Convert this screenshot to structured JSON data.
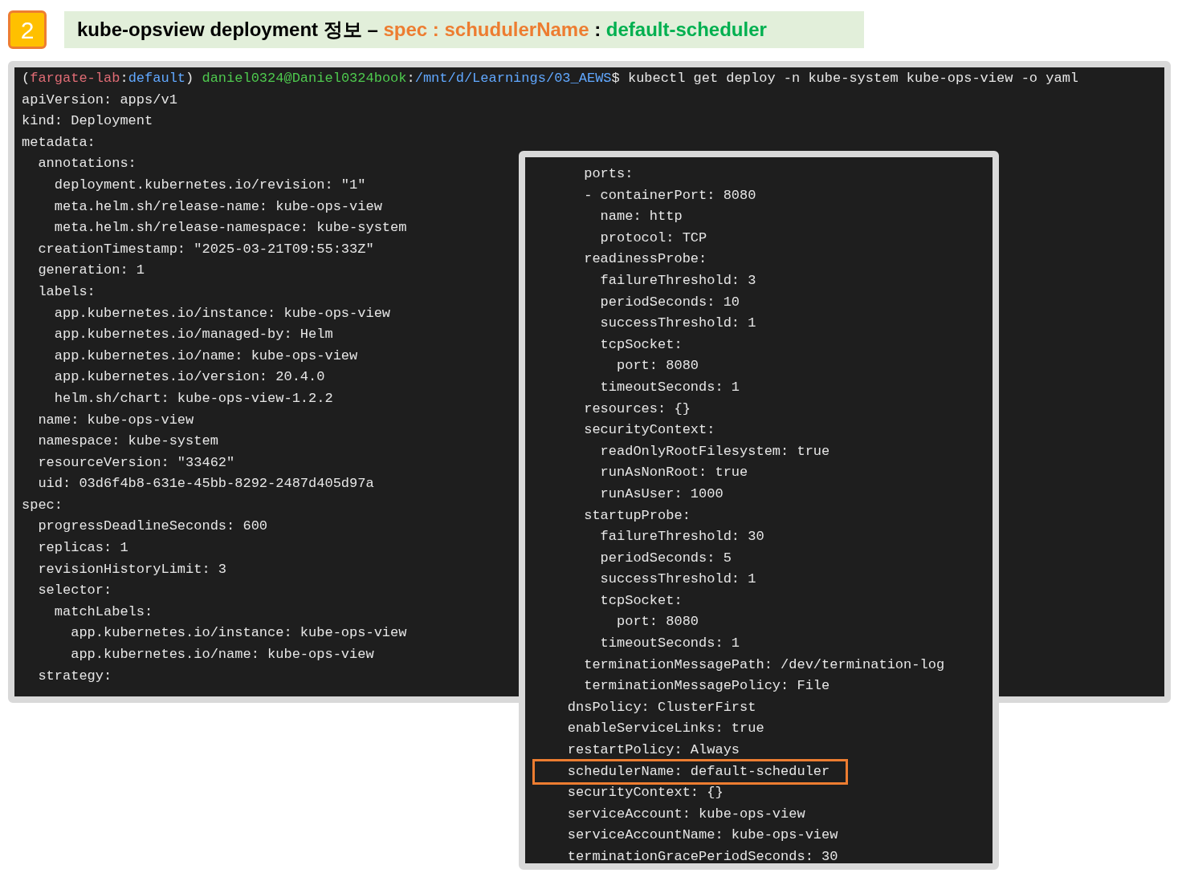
{
  "header": {
    "badge": "2",
    "title": [
      {
        "kind": "plain",
        "text": "kube-opsview deployment 정보 – "
      },
      {
        "kind": "key",
        "text": "spec : schudulerName"
      },
      {
        "kind": "plain",
        "text": " : "
      },
      {
        "kind": "value",
        "text": "default-scheduler"
      }
    ]
  },
  "terminal": {
    "prompt": [
      {
        "kind": "plain",
        "text": "("
      },
      {
        "kind": "context",
        "text": "fargate-lab"
      },
      {
        "kind": "plain",
        "text": ":"
      },
      {
        "kind": "namespace",
        "text": "default"
      },
      {
        "kind": "plain",
        "text": ") "
      },
      {
        "kind": "user",
        "text": "daniel0324@Daniel0324book"
      },
      {
        "kind": "plain",
        "text": ":"
      },
      {
        "kind": "path",
        "text": "/mnt/d/Learnings/03_AEWS"
      },
      {
        "kind": "plain",
        "text": "$ kubectl get deploy -n kube-system kube-ops-view -o yaml"
      }
    ],
    "lines": [
      "apiVersion: apps/v1",
      "kind: Deployment",
      "metadata:",
      "  annotations:",
      "    deployment.kubernetes.io/revision: \"1\"",
      "    meta.helm.sh/release-name: kube-ops-view",
      "    meta.helm.sh/release-namespace: kube-system",
      "  creationTimestamp: \"2025-03-21T09:55:33Z\"",
      "  generation: 1",
      "  labels:",
      "    app.kubernetes.io/instance: kube-ops-view",
      "    app.kubernetes.io/managed-by: Helm",
      "    app.kubernetes.io/name: kube-ops-view",
      "    app.kubernetes.io/version: 20.4.0",
      "    helm.sh/chart: kube-ops-view-1.2.2",
      "  name: kube-ops-view",
      "  namespace: kube-system",
      "  resourceVersion: \"33462\"",
      "  uid: 03d6f4b8-631e-45bb-8292-2487d405d97a",
      "spec:",
      "  progressDeadlineSeconds: 600",
      "  replicas: 1",
      "  revisionHistoryLimit: 3",
      "  selector:",
      "    matchLabels:",
      "      app.kubernetes.io/instance: kube-ops-view",
      "      app.kubernetes.io/name: kube-ops-view",
      "  strategy:"
    ]
  },
  "excerpt": {
    "lines": [
      {
        "text": "      ports:",
        "highlighted": false
      },
      {
        "text": "      - containerPort: 8080",
        "highlighted": false
      },
      {
        "text": "        name: http",
        "highlighted": false
      },
      {
        "text": "        protocol: TCP",
        "highlighted": false
      },
      {
        "text": "      readinessProbe:",
        "highlighted": false
      },
      {
        "text": "        failureThreshold: 3",
        "highlighted": false
      },
      {
        "text": "        periodSeconds: 10",
        "highlighted": false
      },
      {
        "text": "        successThreshold: 1",
        "highlighted": false
      },
      {
        "text": "        tcpSocket:",
        "highlighted": false
      },
      {
        "text": "          port: 8080",
        "highlighted": false
      },
      {
        "text": "        timeoutSeconds: 1",
        "highlighted": false
      },
      {
        "text": "      resources: {}",
        "highlighted": false
      },
      {
        "text": "      securityContext:",
        "highlighted": false
      },
      {
        "text": "        readOnlyRootFilesystem: true",
        "highlighted": false
      },
      {
        "text": "        runAsNonRoot: true",
        "highlighted": false
      },
      {
        "text": "        runAsUser: 1000",
        "highlighted": false
      },
      {
        "text": "      startupProbe:",
        "highlighted": false
      },
      {
        "text": "        failureThreshold: 30",
        "highlighted": false
      },
      {
        "text": "        periodSeconds: 5",
        "highlighted": false
      },
      {
        "text": "        successThreshold: 1",
        "highlighted": false
      },
      {
        "text": "        tcpSocket:",
        "highlighted": false
      },
      {
        "text": "          port: 8080",
        "highlighted": false
      },
      {
        "text": "        timeoutSeconds: 1",
        "highlighted": false
      },
      {
        "text": "      terminationMessagePath: /dev/termination-log",
        "highlighted": false
      },
      {
        "text": "      terminationMessagePolicy: File",
        "highlighted": false
      },
      {
        "text": "    dnsPolicy: ClusterFirst",
        "highlighted": false
      },
      {
        "text": "    enableServiceLinks: true",
        "highlighted": false
      },
      {
        "text": "    restartPolicy: Always",
        "highlighted": false
      },
      {
        "text": "    schedulerName: default-scheduler",
        "highlighted": true
      },
      {
        "text": "    securityContext: {}",
        "highlighted": false
      },
      {
        "text": "    serviceAccount: kube-ops-view",
        "highlighted": false
      },
      {
        "text": "    serviceAccountName: kube-ops-view",
        "highlighted": false
      },
      {
        "text": "    terminationGracePeriodSeconds: 30",
        "highlighted": false
      }
    ]
  }
}
